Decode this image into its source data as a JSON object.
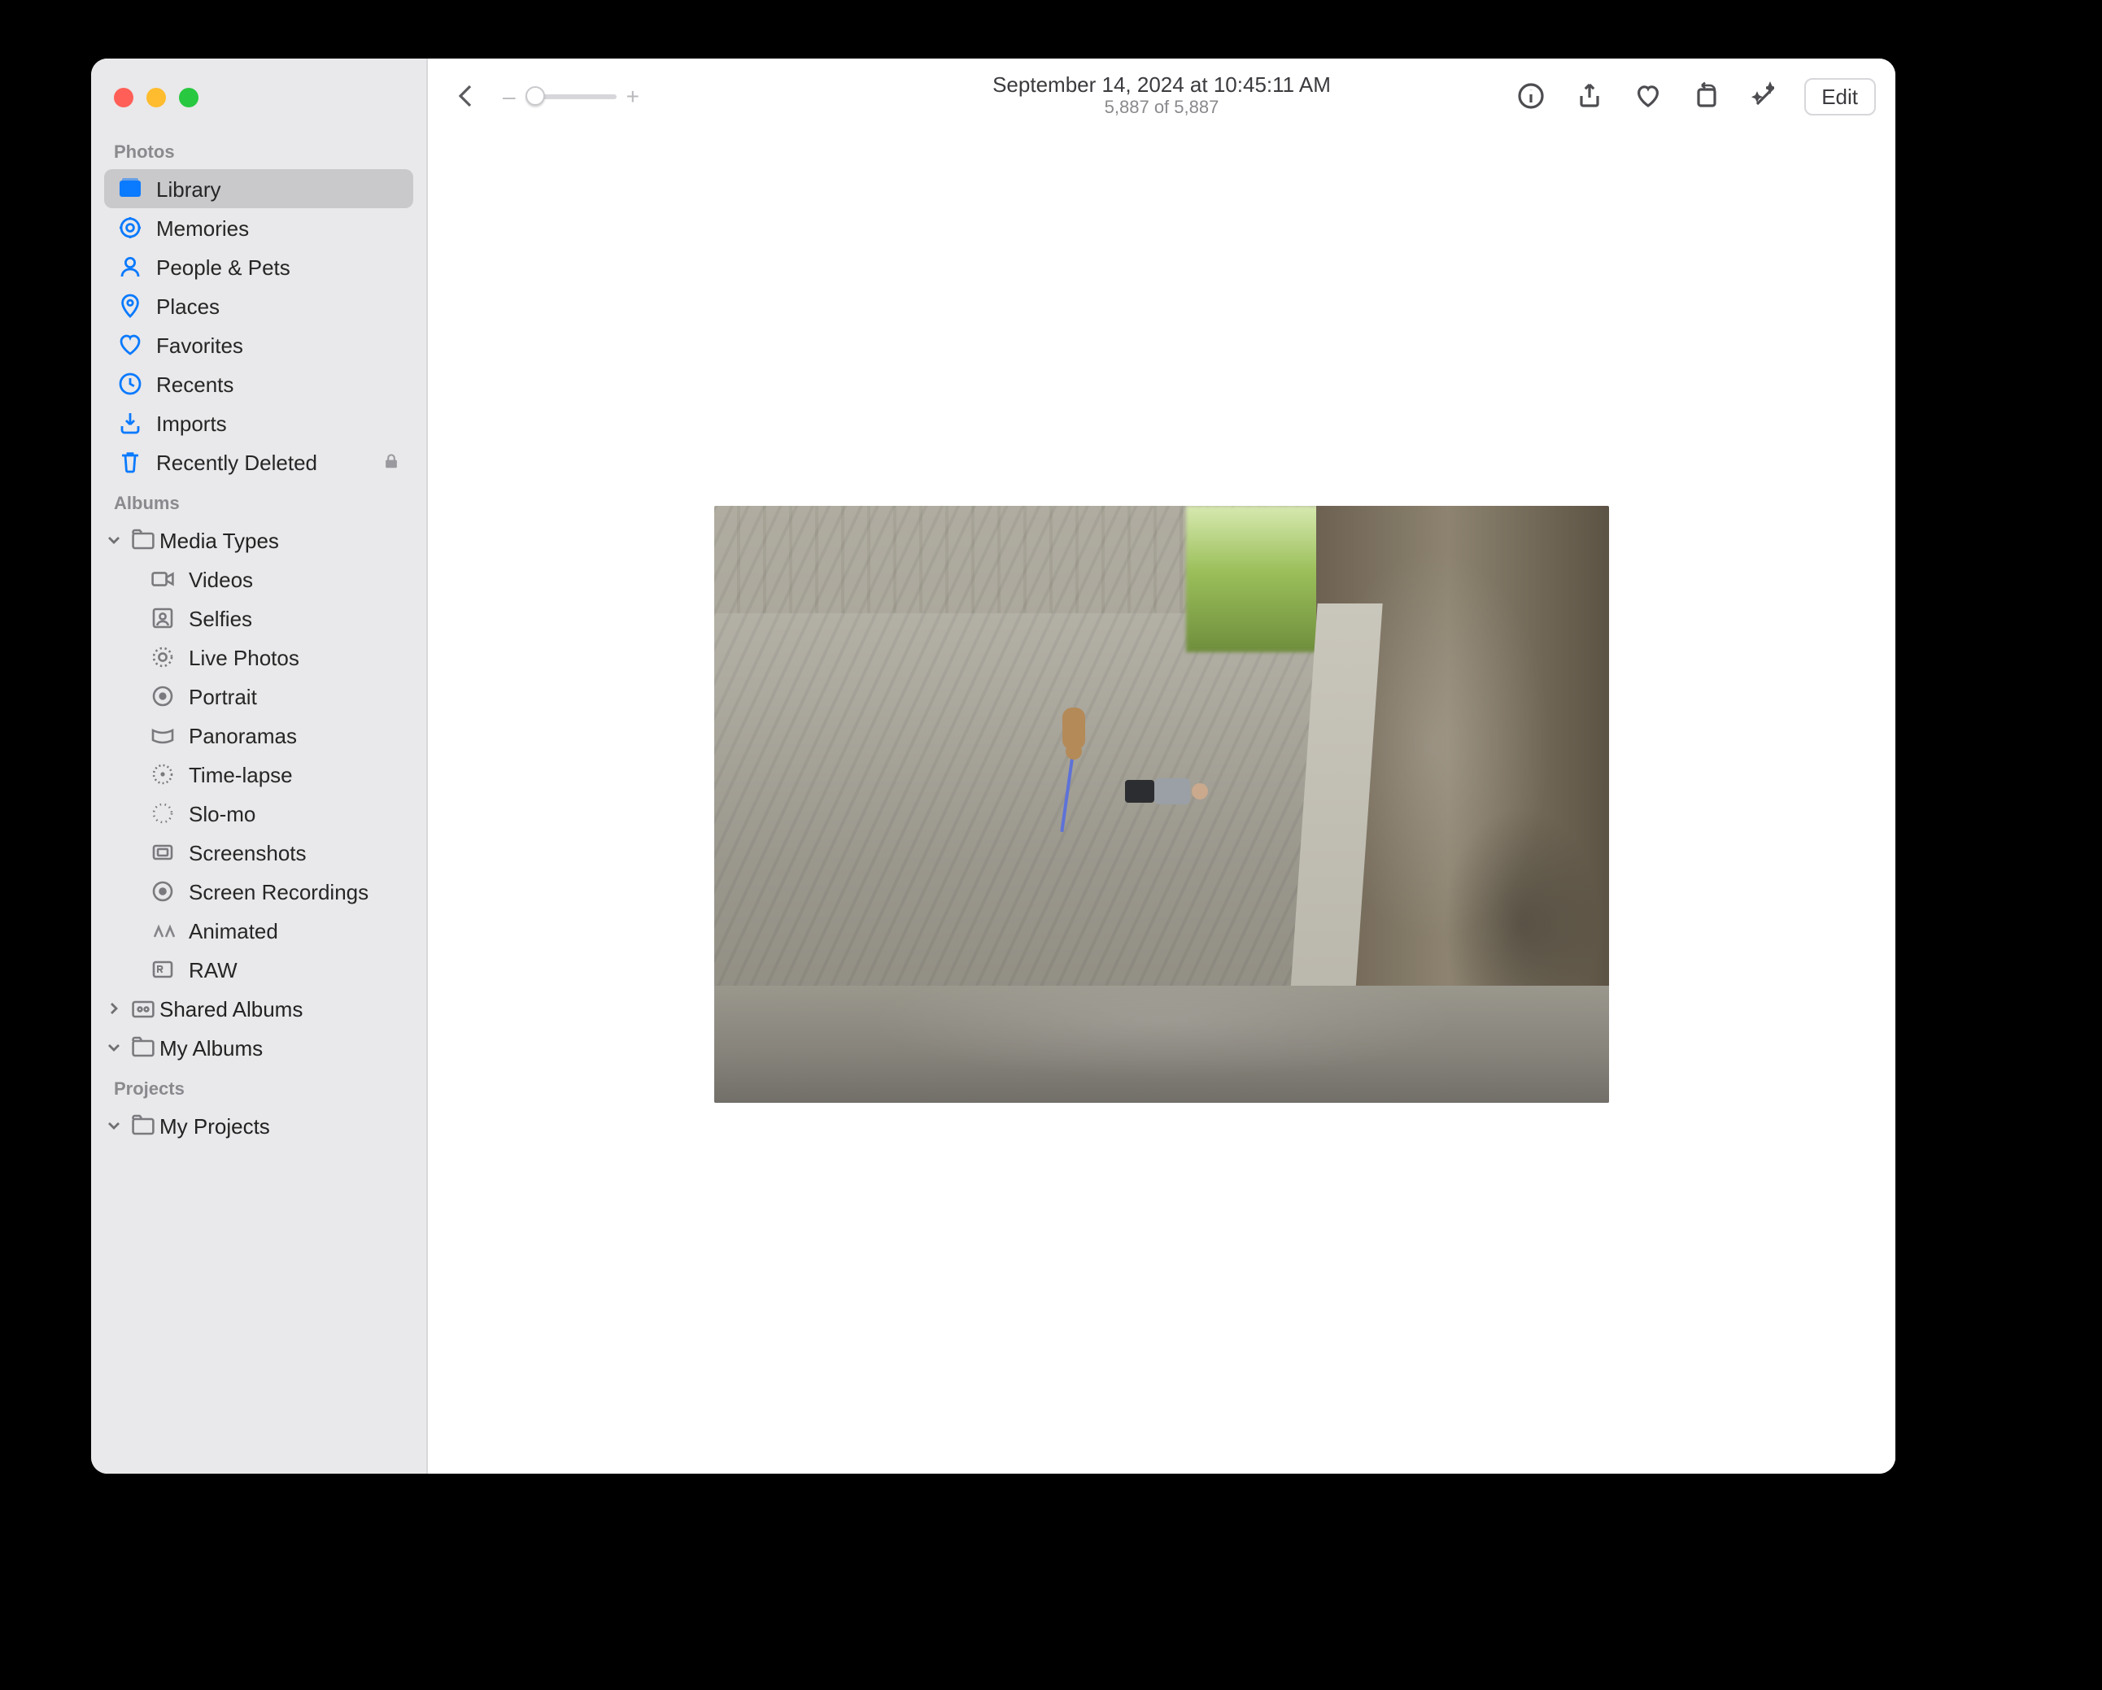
{
  "toolbar": {
    "title": "September 14, 2024 at 10:45:11 AM",
    "subtitle": "5,887 of 5,887",
    "zoom_minus": "–",
    "zoom_plus": "+",
    "edit_label": "Edit"
  },
  "sidebar": {
    "section_photos": "Photos",
    "items": [
      {
        "label": "Library"
      },
      {
        "label": "Memories"
      },
      {
        "label": "People & Pets"
      },
      {
        "label": "Places"
      },
      {
        "label": "Favorites"
      },
      {
        "label": "Recents"
      },
      {
        "label": "Imports"
      },
      {
        "label": "Recently Deleted"
      }
    ],
    "section_albums": "Albums",
    "media_types_label": "Media Types",
    "media_types": [
      {
        "label": "Videos"
      },
      {
        "label": "Selfies"
      },
      {
        "label": "Live Photos"
      },
      {
        "label": "Portrait"
      },
      {
        "label": "Panoramas"
      },
      {
        "label": "Time-lapse"
      },
      {
        "label": "Slo-mo"
      },
      {
        "label": "Screenshots"
      },
      {
        "label": "Screen Recordings"
      },
      {
        "label": "Animated"
      },
      {
        "label": "RAW"
      }
    ],
    "shared_albums_label": "Shared Albums",
    "my_albums_label": "My Albums",
    "section_projects": "Projects",
    "my_projects_label": "My Projects"
  }
}
